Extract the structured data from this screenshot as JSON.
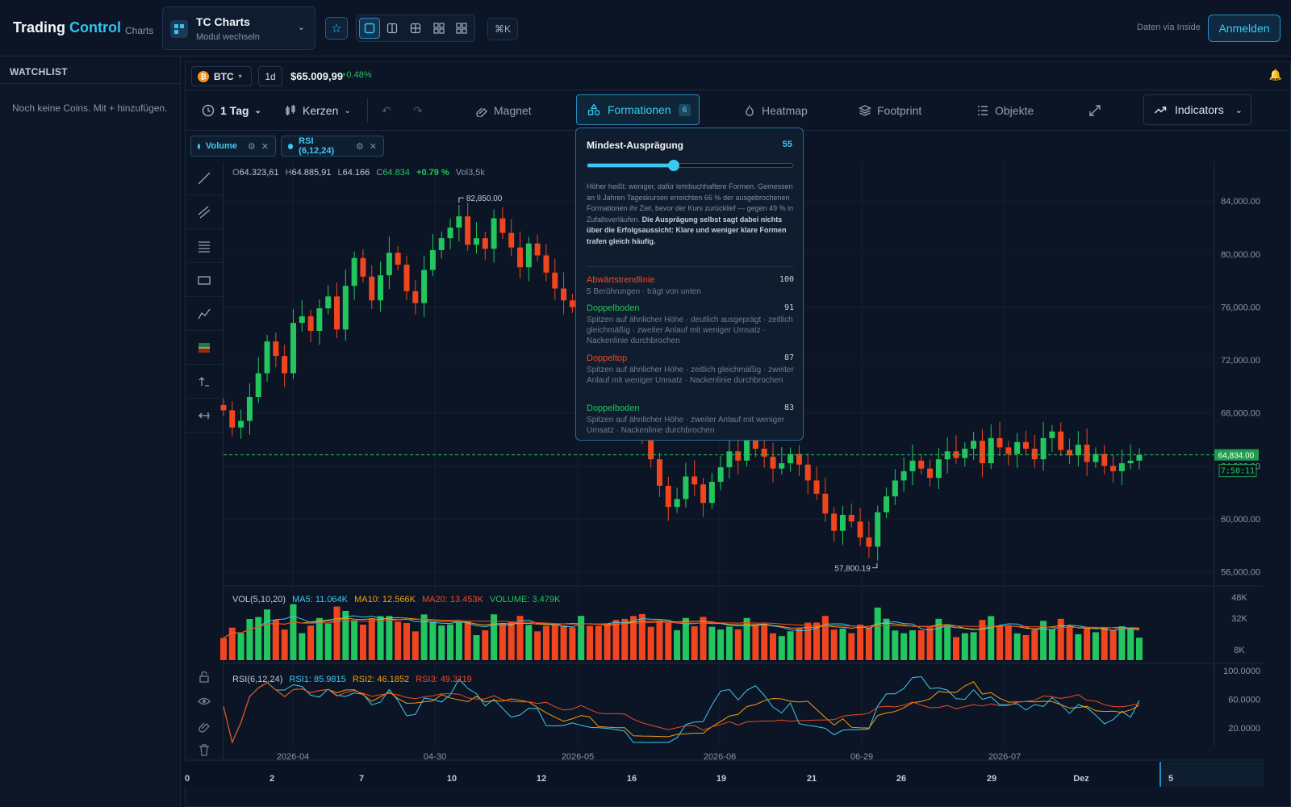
{
  "header": {
    "brand_main": "Trading",
    "brand_accent": "Control",
    "brand_sub": "Charts",
    "module_title": "TC Charts",
    "module_sub": "Modul wechseln",
    "cmdk": "⌘K",
    "data_via": "Daten via Inside",
    "login": "Anmelden"
  },
  "watchlist": {
    "title": "WATCHLIST",
    "empty": "Noch keine Coins. Mit + hinzufügen."
  },
  "symbol_bar": {
    "symbol": "BTC",
    "timeframe": "1d",
    "price": "$65.009,99",
    "change": "+0.48%"
  },
  "toolbar": {
    "interval": "1 Tag",
    "chart_type": "Kerzen",
    "magnet": "Magnet",
    "formationen": "Formationen",
    "formationen_count": "6",
    "heatmap": "Heatmap",
    "footprint": "Footprint",
    "objekte": "Objekte",
    "indicators": "Indicators"
  },
  "chips": [
    {
      "label": "Volume"
    },
    {
      "label": "RSI (6,12,24)"
    }
  ],
  "ohlc": {
    "o_label": "O",
    "o": "64.323,61",
    "h_label": "H",
    "h": "64.885,91",
    "l_label": "L",
    "l": "64.166",
    "c_label": "C",
    "c": "64.834",
    "chg": "+0.79 %",
    "vol_label": "Vol",
    "vol": "3,5k"
  },
  "vol_pane": {
    "title": "VOL(5,10,20)",
    "ma5": "MA5: 11.064K",
    "ma10": "MA10: 12.566K",
    "ma20": "MA20: 13.453K",
    "volume": "VOLUME: 3.479K"
  },
  "rsi_pane": {
    "title": "RSI(6,12,24)",
    "rsi1": "RSI1: 85.9815",
    "rsi2": "RSI2: 46.1852",
    "rsi3": "RSI3: 49.3119"
  },
  "popup": {
    "title": "Mindest-Ausprägung",
    "value": "55",
    "slider_fraction": 0.42,
    "desc": "Höher heißt: weniger, dafür lehrbuchhaftere Formen. Gemessen an 9 Jahren Tageskursen erreichten 66 % der ausgebrochenen Formationen ihr Ziel, bevor der Kurs zurücklief — gegen 49 % in Zufallsverläufen.",
    "desc_bold": "Die Ausprägung selbst sagt dabei nichts über die Erfolgsaussicht: Klare und weniger klare Formen trafen gleich häufig.",
    "patterns": [
      {
        "name": "Abwärtstrendlinie",
        "score": "100",
        "desc": "5 Berührungen · trägt von unten",
        "color": "#ef4a24"
      },
      {
        "name": "Doppelboden",
        "score": "91",
        "desc": "Spitzen auf ähnlicher Höhe · deutlich ausgeprägt · zeitlich gleichmäßig · zweiter Anlauf mit weniger Umsatz · Nackenlinie durchbrochen",
        "color": "#22c55e"
      },
      {
        "name": "Doppeltop",
        "score": "87",
        "desc": "Spitzen auf ähnlicher Höhe · zeitlich gleichmäßig · zweiter Anlauf mit weniger Umsatz · Nackenlinie durchbrochen",
        "color": "#ef4a24"
      },
      {
        "name": "Doppelboden",
        "score": "83",
        "desc": "Spitzen auf ähnlicher Höhe · zweiter Anlauf mit weniger Umsatz · Nackenlinie durchbrochen",
        "color": "#22c55e"
      }
    ]
  },
  "chart_data": {
    "type": "candlestick",
    "price_axis": [
      "84,000.00",
      "80,000.00",
      "76,000.00",
      "72,000.00",
      "68,000.00",
      "64,000.00",
      "60,000.00",
      "56,000.00"
    ],
    "price_axis_values": [
      84000,
      80000,
      76000,
      72000,
      68000,
      64000,
      60000,
      56000
    ],
    "y_range": [
      55000,
      87000
    ],
    "last_price": "64,834.00",
    "last_price_value": 64834,
    "countdown": "7:50:11",
    "high_marker": "82,850.00",
    "high_marker_value": 82850,
    "low_marker": "57,800.19",
    "low_marker_value": 57800.19,
    "time_labels": [
      "2026-04",
      "04-30",
      "2026-05",
      "2026-06",
      "06-29",
      "2026-07"
    ],
    "bottom_labels": [
      "0",
      "2",
      "7",
      "10",
      "12",
      "16",
      "19",
      "21",
      "26",
      "29",
      "Dez",
      "5"
    ],
    "vol_axis": [
      "48K",
      "32K",
      "8K"
    ],
    "vol_axis_values": [
      48,
      32,
      8
    ],
    "rsi_axis": [
      "100.0000",
      "60.0000",
      "20.0000"
    ],
    "rsi_axis_values": [
      100,
      60,
      20
    ],
    "closes": [
      68200,
      66900,
      67400,
      69200,
      71000,
      73400,
      72300,
      71000,
      74800,
      75300,
      74200,
      75900,
      76800,
      74300,
      77600,
      79700,
      78300,
      76500,
      78400,
      80100,
      79200,
      77200,
      76300,
      78800,
      80300,
      81200,
      82000,
      82850,
      80700,
      81200,
      80400,
      82700,
      81600,
      80500,
      79000,
      80800,
      79900,
      78600,
      77400,
      76500,
      76000,
      77500,
      75800,
      74300,
      72800,
      71100,
      69500,
      67800,
      66100,
      64500,
      62500,
      60900,
      61500,
      63200,
      62600,
      61200,
      62800,
      63900,
      65100,
      64400,
      66100,
      65300,
      64700,
      63800,
      64200,
      64900,
      64100,
      62900,
      61900,
      60400,
      59100,
      60300,
      59800,
      58600,
      57900,
      60500,
      61700,
      62900,
      63600,
      64400,
      63800,
      63100,
      64500,
      65100,
      64600,
      65300,
      65900,
      64200,
      66100,
      65400,
      64900,
      65800,
      65300,
      64500,
      66100,
      66600,
      65200,
      64800,
      65600,
      64300,
      64900,
      64000,
      63600,
      64200,
      64400,
      64834
    ]
  }
}
